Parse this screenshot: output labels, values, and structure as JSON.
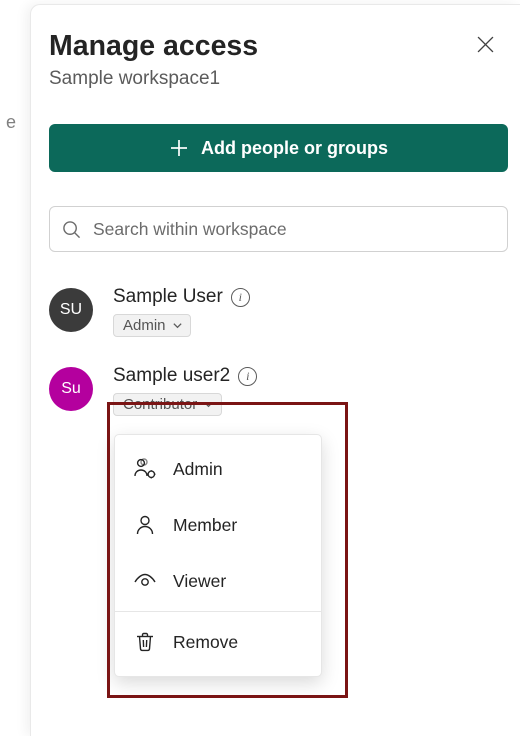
{
  "header": {
    "title": "Manage access",
    "subtitle": "Sample workspace1"
  },
  "add_button": {
    "label": "Add people or groups"
  },
  "search": {
    "placeholder": "Search within workspace"
  },
  "users": [
    {
      "initials": "SU",
      "name": "Sample User",
      "role": "Admin",
      "avatar_color": "#3b3b3b"
    },
    {
      "initials": "Su",
      "name": "Sample user2",
      "role": "Contributor",
      "avatar_color": "#b4009e"
    }
  ],
  "role_menu": {
    "options": [
      "Admin",
      "Member",
      "Viewer",
      "Remove"
    ]
  },
  "colors": {
    "accent": "#0c695a",
    "highlight_border": "#7a1414"
  }
}
